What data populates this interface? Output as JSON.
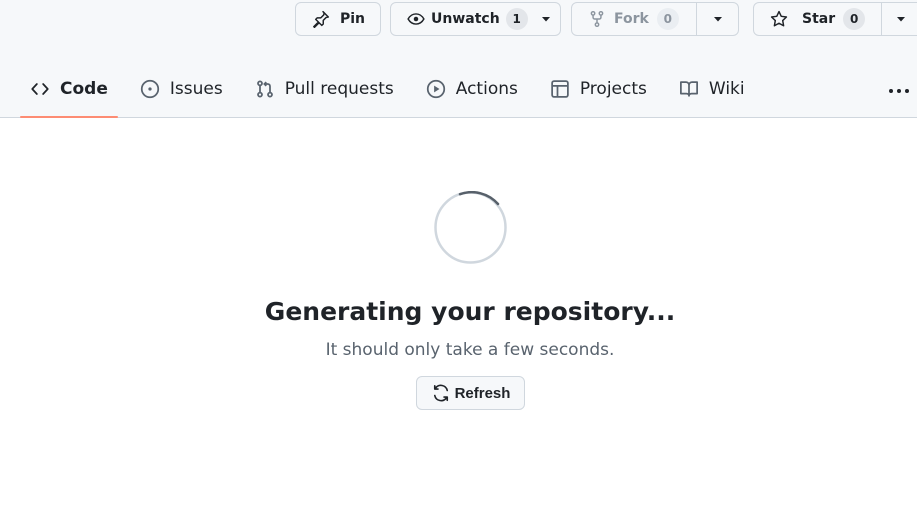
{
  "repo_actions": {
    "pin": {
      "label": "Pin",
      "icon": "pin-icon"
    },
    "watch": {
      "label": "Unwatch",
      "count": "1",
      "icon": "eye-icon"
    },
    "fork": {
      "label": "Fork",
      "count": "0",
      "icon": "repo-forked-icon"
    },
    "star": {
      "label": "Star",
      "count": "0",
      "icon": "star-icon"
    }
  },
  "tabs": [
    {
      "label": "Code",
      "icon": "code-icon",
      "selected": true
    },
    {
      "label": "Issues",
      "icon": "issue-opened-icon"
    },
    {
      "label": "Pull requests",
      "icon": "git-pull-request-icon"
    },
    {
      "label": "Actions",
      "icon": "play-icon"
    },
    {
      "label": "Projects",
      "icon": "table-icon"
    },
    {
      "label": "Wiki",
      "icon": "book-icon"
    }
  ],
  "main": {
    "title": "Generating your repository...",
    "subtitle": "It should only take a few seconds.",
    "refresh_label": "Refresh"
  },
  "colors": {
    "tab_underline": "#fd8c73",
    "header_bg": "#f6f8fa",
    "border": "#d0d7de",
    "text": "#1f2328",
    "muted": "#59636e"
  }
}
